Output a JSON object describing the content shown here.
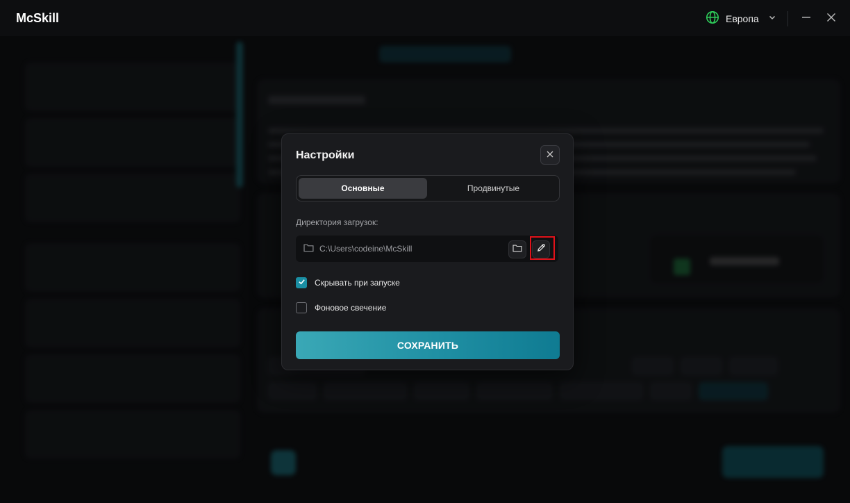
{
  "app": {
    "title": "McSkill"
  },
  "titlebar": {
    "region_label": "Европа"
  },
  "modal": {
    "title": "Настройки",
    "tabs": [
      {
        "label": "Основные",
        "active": true
      },
      {
        "label": "Продвинутые",
        "active": false
      }
    ],
    "directory_label": "Директория загрузок:",
    "directory_value": "C:\\Users\\codeine\\McSkill",
    "options": [
      {
        "label": "Скрывать при запуске",
        "checked": true
      },
      {
        "label": "Фоновое свечение",
        "checked": false
      }
    ],
    "save_label": "СОХРАНИТЬ"
  },
  "colors": {
    "accent": "#1a8ea3",
    "highlight": "#e1121a",
    "status_online": "#2db35b"
  },
  "icons": {
    "region": "globe-icon",
    "region_dropdown": "chevron-down-icon",
    "minimize": "minimize-icon",
    "close_window": "close-icon",
    "close_modal": "close-icon",
    "field_folder": "folder-icon",
    "browse": "folder-icon",
    "edit": "pencil-icon",
    "checked": "check-icon"
  }
}
